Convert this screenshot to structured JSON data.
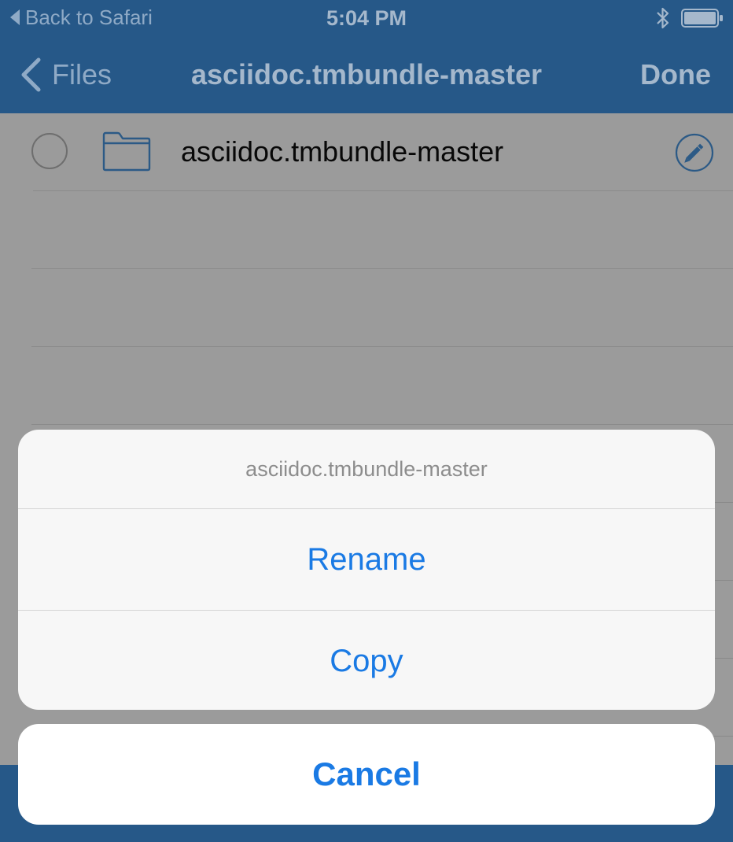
{
  "status_bar": {
    "back_label": "Back to Safari",
    "time": "5:04 PM",
    "icons": [
      "back-triangle-icon",
      "bluetooth-icon",
      "battery-icon"
    ]
  },
  "nav": {
    "back_label": "Files",
    "title": "asciidoc.tmbundle-master",
    "done_label": "Done"
  },
  "list": {
    "items": [
      {
        "name": "asciidoc.tmbundle-master",
        "icon": "folder-icon",
        "action_icon": "pencil-icon"
      }
    ]
  },
  "action_sheet": {
    "title": "asciidoc.tmbundle-master",
    "actions": [
      "Rename",
      "Copy"
    ],
    "cancel_label": "Cancel"
  },
  "colors": {
    "nav_blue": "#265888",
    "accent_blue": "#1a7ae4",
    "dim_overlay": "#9b9b9b"
  }
}
